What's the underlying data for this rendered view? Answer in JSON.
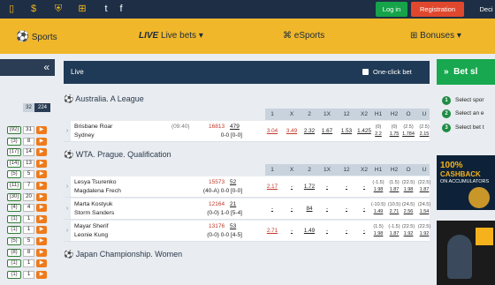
{
  "topbar": {
    "icons": [
      "mobile-icon",
      "dollar-icon",
      "shield-icon",
      "gift-icon",
      "twitter-icon",
      "facebook-icon"
    ],
    "login": "Log in",
    "registration": "Registration",
    "decimal": "Deci"
  },
  "nav": {
    "sports": "Sports",
    "live_prefix": "LIVE",
    "live": "Live bets",
    "esports": "eSports",
    "bonuses": "Bonuses"
  },
  "left": {
    "collapse": "«",
    "counts": [
      "32",
      "224"
    ],
    "rows": [
      "(92)",
      "(3)",
      "(17)",
      "(14)",
      "(5)",
      "(11)",
      "(30)",
      "(4)",
      "(1)",
      "(1)",
      "(5)",
      "(8)",
      "(1)",
      "(1)"
    ],
    "bars": [
      "31",
      "8",
      "14",
      "13",
      "5",
      "7",
      "20",
      "4",
      "1",
      "1",
      "5",
      "8",
      "1",
      "1"
    ]
  },
  "live": {
    "title": "Live",
    "one_click": "One-click bet"
  },
  "headers": [
    "1",
    "X",
    "2",
    "1X",
    "12",
    "X2",
    "H1",
    "H2",
    "O",
    "U"
  ],
  "sections": [
    {
      "title": "Australia. A League",
      "matches": [
        {
          "team1": "Brisbane Roar",
          "team2": "Sydney",
          "time": "(09:40)",
          "score1": "16813",
          "score2": "479",
          "sub": "0-0 [0-0]",
          "odds": [
            "3.04",
            "3.49",
            "2.32",
            "1.67",
            "1.53",
            "1.425"
          ],
          "h1": [
            "(0)",
            "2.2"
          ],
          "h2": [
            "(0)",
            "1.75"
          ],
          "o": [
            "(2.5)",
            "1.784"
          ],
          "u": [
            "(2.5)",
            "2.15"
          ]
        }
      ]
    },
    {
      "title": "WTA. Prague. Qualification",
      "matches": [
        {
          "team1": "Lesya Tsurenko",
          "team2": "Magdalena Frech",
          "time": "",
          "score1": "15573",
          "score2": "52",
          "sub": "(40-A) 0-0 [0-0]",
          "odds": [
            "2.17",
            "-",
            "1.72",
            "-",
            "-",
            "-"
          ],
          "h1": [
            "(-1.5)",
            "1.98"
          ],
          "h2": [
            "(1.5)",
            "1.87"
          ],
          "o": [
            "(22.5)",
            "1.98"
          ],
          "u": [
            "(22.5)",
            "1.87"
          ]
        },
        {
          "team1": "Marta Kostyuk",
          "team2": "Storm Sanders",
          "time": "",
          "score1": "12164",
          "score2": "21",
          "sub": "(0-0) 1-0 [5-4]",
          "odds": [
            "-",
            "-",
            "84",
            "-",
            "-",
            "-"
          ],
          "h1": [
            "(-10.5)",
            "1.49"
          ],
          "h2": [
            "(10.5)",
            "2.71"
          ],
          "o": [
            "(24.5)",
            "2.56"
          ],
          "u": [
            "(24.5)",
            "1.54"
          ]
        },
        {
          "team1": "Mayar Sherif",
          "team2": "Leonie Kung",
          "time": "",
          "score1": "13176",
          "score2": "53",
          "sub": "(0-0) 0-0 [4-5]",
          "odds": [
            "2.71",
            "-",
            "1.49",
            "-",
            "-",
            "-"
          ],
          "h1": [
            "(1.5)",
            "1.98"
          ],
          "h2": [
            "(-1.5)",
            "1.87"
          ],
          "o": [
            "(22.5)",
            "1.92"
          ],
          "u": [
            "(22.5)",
            "1.92"
          ]
        }
      ]
    },
    {
      "title": "Japan Championship. Women",
      "matches": []
    }
  ],
  "betslip": {
    "title": "Bet sl",
    "steps": [
      "Select spor",
      "Select an e",
      "Select bet t"
    ],
    "promo1_line1": "100%",
    "promo1_line2": "CASHBACK",
    "promo1_line3": "ON ACCUMULATORS"
  },
  "colors": {
    "topbar": "#1e2f45",
    "nav": "#f0b72a",
    "live": "#1f3a56",
    "green": "#18a84f",
    "odds": "#c0392b"
  }
}
